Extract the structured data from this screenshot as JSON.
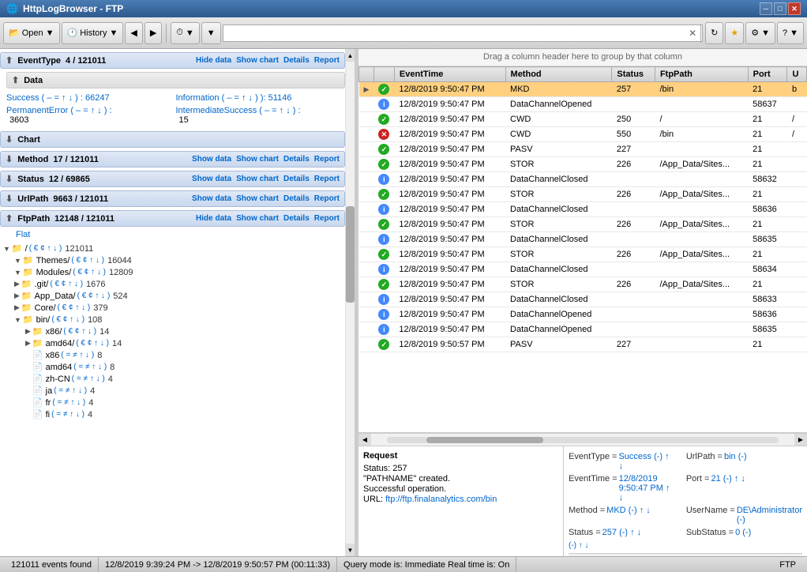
{
  "app": {
    "title": "HttpLogBrowser - FTP"
  },
  "titlebar": {
    "minimize": "─",
    "maximize": "□",
    "close": "✕"
  },
  "toolbar": {
    "open_label": "Open",
    "history_label": "History",
    "search_placeholder": "",
    "refresh_label": "↻",
    "filter_label": "▼"
  },
  "left_panel": {
    "event_type_header": "EventType",
    "event_type_count": "4 / 121011",
    "event_type_links": [
      "Hide data",
      "Show chart",
      "Details",
      "Report"
    ],
    "data_header": "Data",
    "success_label": "Success",
    "success_controls": "( –  =  ↑  ↓ )",
    "success_value": ": 66247",
    "information_label": "Information",
    "information_controls": "( –  =  ↑  ↓ )",
    "information_value": "): 51146",
    "permanent_error_label": "PermanentError",
    "permanent_error_controls": "( –  =  ↑  ↓ )",
    "permanent_error_value": "3603",
    "intermediate_success_label": "IntermediateSuccess",
    "intermediate_success_controls": "( –  =  ↑  ↓ )",
    "intermediate_success_value": "15",
    "chart_header": "Chart",
    "method_header": "Method",
    "method_count": "17 / 121011",
    "method_links": [
      "Show data",
      "Show chart",
      "Details",
      "Report"
    ],
    "status_header": "Status",
    "status_count": "12 / 69865",
    "status_links": [
      "Show data",
      "Show chart",
      "Details",
      "Report"
    ],
    "urlpath_header": "UrlPath",
    "urlpath_count": "9663 / 121011",
    "urlpath_links": [
      "Show data",
      "Show chart",
      "Details",
      "Report"
    ],
    "ftppath_header": "FtpPath",
    "ftppath_count": "12148 / 121011",
    "ftppath_links": [
      "Hide data",
      "Show chart",
      "Details",
      "Report"
    ],
    "ftppath_sub": "Flat",
    "tree_items": [
      {
        "indent": 0,
        "expand": true,
        "type": "folder",
        "name": "/",
        "controls": "( € ¢ ↑ ↓ )",
        "count": "121011"
      },
      {
        "indent": 1,
        "expand": true,
        "type": "folder",
        "name": "Themes/",
        "controls": "( € ¢ ↑ ↓ )",
        "count": "16044"
      },
      {
        "indent": 1,
        "expand": true,
        "type": "folder",
        "name": "Modules/",
        "controls": "( € ¢ ↑ ↓ )",
        "count": "12809"
      },
      {
        "indent": 1,
        "expand": false,
        "type": "folder",
        "name": ".git/",
        "controls": "( € ¢ ↑ ↓ )",
        "count": "1676"
      },
      {
        "indent": 1,
        "expand": false,
        "type": "folder",
        "name": "App_Data/",
        "controls": "( € ¢ ↑ ↓ )",
        "count": "524"
      },
      {
        "indent": 1,
        "expand": false,
        "type": "folder",
        "name": "Core/",
        "controls": "( € ¢ ↑ ↓ )",
        "count": "379"
      },
      {
        "indent": 1,
        "expand": true,
        "type": "folder",
        "name": "bin/",
        "controls": "( € ¢ ↑ ↓ )",
        "count": "108"
      },
      {
        "indent": 2,
        "expand": false,
        "type": "folder",
        "name": "x86/",
        "controls": "( € ¢ ↑ ↓ )",
        "count": "14"
      },
      {
        "indent": 2,
        "expand": false,
        "type": "folder",
        "name": "amd64/",
        "controls": "( € ¢ ↑ ↓ )",
        "count": "14"
      },
      {
        "indent": 2,
        "expand": false,
        "type": "file",
        "name": "x86",
        "controls": "( = ≠ ↑ ↓ )",
        "count": "8"
      },
      {
        "indent": 2,
        "expand": false,
        "type": "file",
        "name": "amd64",
        "controls": "( = ≠ ↑ ↓ )",
        "count": "8"
      },
      {
        "indent": 2,
        "expand": false,
        "type": "file",
        "name": "zh-CN",
        "controls": "( = ≠ ↑ ↓ )",
        "count": "4"
      },
      {
        "indent": 2,
        "expand": false,
        "type": "file",
        "name": "ja",
        "controls": "( = ≠ ↑ ↓ )",
        "count": "4"
      },
      {
        "indent": 2,
        "expand": false,
        "type": "file",
        "name": "fr",
        "controls": "( = ≠ ↑ ↓ )",
        "count": "4"
      },
      {
        "indent": 2,
        "expand": false,
        "type": "file",
        "name": "fi",
        "controls": "( = ≠ ↑ ↓ )",
        "count": "4"
      }
    ]
  },
  "right_panel": {
    "group_header": "Drag a column header here to group by that column",
    "columns": [
      "",
      "",
      "EventTime",
      "Method",
      "Status",
      "FtpPath",
      "Port",
      "U"
    ],
    "rows": [
      {
        "expand": true,
        "status": "green",
        "event_time": "12/8/2019 9:50:47 PM",
        "method": "MKD",
        "status_code": "257",
        "ftp_path": "/bin",
        "port": "21",
        "u": "b",
        "selected": true
      },
      {
        "expand": false,
        "status": "blue",
        "event_time": "12/8/2019 9:50:47 PM",
        "method": "DataChannelOpened",
        "status_code": "",
        "ftp_path": "",
        "port": "58637",
        "u": ""
      },
      {
        "expand": false,
        "status": "green",
        "event_time": "12/8/2019 9:50:47 PM",
        "method": "CWD",
        "status_code": "250",
        "ftp_path": "/",
        "port": "21",
        "u": "/"
      },
      {
        "expand": false,
        "status": "red",
        "event_time": "12/8/2019 9:50:47 PM",
        "method": "CWD",
        "status_code": "550",
        "ftp_path": "/bin",
        "port": "21",
        "u": "/"
      },
      {
        "expand": false,
        "status": "green",
        "event_time": "12/8/2019 9:50:47 PM",
        "method": "PASV",
        "status_code": "227",
        "ftp_path": "",
        "port": "21",
        "u": ""
      },
      {
        "expand": false,
        "status": "green",
        "event_time": "12/8/2019 9:50:47 PM",
        "method": "STOR",
        "status_code": "226",
        "ftp_path": "/App_Data/Sites...",
        "port": "21",
        "u": ""
      },
      {
        "expand": false,
        "status": "blue",
        "event_time": "12/8/2019 9:50:47 PM",
        "method": "DataChannelClosed",
        "status_code": "",
        "ftp_path": "",
        "port": "58632",
        "u": ""
      },
      {
        "expand": false,
        "status": "green",
        "event_time": "12/8/2019 9:50:47 PM",
        "method": "STOR",
        "status_code": "226",
        "ftp_path": "/App_Data/Sites...",
        "port": "21",
        "u": ""
      },
      {
        "expand": false,
        "status": "blue",
        "event_time": "12/8/2019 9:50:47 PM",
        "method": "DataChannelClosed",
        "status_code": "",
        "ftp_path": "",
        "port": "58636",
        "u": ""
      },
      {
        "expand": false,
        "status": "green",
        "event_time": "12/8/2019 9:50:47 PM",
        "method": "STOR",
        "status_code": "226",
        "ftp_path": "/App_Data/Sites...",
        "port": "21",
        "u": ""
      },
      {
        "expand": false,
        "status": "blue",
        "event_time": "12/8/2019 9:50:47 PM",
        "method": "DataChannelClosed",
        "status_code": "",
        "ftp_path": "",
        "port": "58635",
        "u": ""
      },
      {
        "expand": false,
        "status": "green",
        "event_time": "12/8/2019 9:50:47 PM",
        "method": "STOR",
        "status_code": "226",
        "ftp_path": "/App_Data/Sites...",
        "port": "21",
        "u": ""
      },
      {
        "expand": false,
        "status": "blue",
        "event_time": "12/8/2019 9:50:47 PM",
        "method": "DataChannelClosed",
        "status_code": "",
        "ftp_path": "",
        "port": "58634",
        "u": ""
      },
      {
        "expand": false,
        "status": "green",
        "event_time": "12/8/2019 9:50:47 PM",
        "method": "STOR",
        "status_code": "226",
        "ftp_path": "/App_Data/Sites...",
        "port": "21",
        "u": ""
      },
      {
        "expand": false,
        "status": "blue",
        "event_time": "12/8/2019 9:50:47 PM",
        "method": "DataChannelClosed",
        "status_code": "",
        "ftp_path": "",
        "port": "58633",
        "u": ""
      },
      {
        "expand": false,
        "status": "blue",
        "event_time": "12/8/2019 9:50:47 PM",
        "method": "DataChannelOpened",
        "status_code": "",
        "ftp_path": "",
        "port": "58636",
        "u": ""
      },
      {
        "expand": false,
        "status": "blue",
        "event_time": "12/8/2019 9:50:47 PM",
        "method": "DataChannelOpened",
        "status_code": "",
        "ftp_path": "",
        "port": "58635",
        "u": ""
      },
      {
        "expand": false,
        "status": "green",
        "event_time": "12/8/2019 9:50:57 PM",
        "method": "PASV",
        "status_code": "227",
        "ftp_path": "",
        "port": "21",
        "u": ""
      }
    ]
  },
  "request_panel": {
    "title": "Request",
    "status_line": "Status: 257",
    "message": "\"PATHNAME\" created.",
    "success": "Successful operation.",
    "url_label": "URL:",
    "url": "ftp://ftp.finalanalytics.com/bin"
  },
  "details_panel": {
    "event_type_label": "EventType =",
    "event_type_val": "Success",
    "event_type_controls": "(-) ↑ ↓",
    "url_path_label": "UrlPath =",
    "url_path_val": "bin",
    "url_path_suffix": "(-)",
    "event_time_label": "EventTime =",
    "event_time_val": "12/8/2019 9:50:47 PM",
    "event_time_controls": "↑ ↓",
    "port_label": "Port =",
    "port_val": "21",
    "port_controls": "(-) ↑ ↓",
    "method_label": "Method =",
    "method_val": "MKD",
    "method_controls": "(-) ↑ ↓",
    "username_label": "UserName =",
    "username_val": "DE\\Administrator (-)",
    "status_label": "Status =",
    "status_val": "257",
    "status_controls": "(-) ↑ ↓",
    "substatus_label": "SubStatus =",
    "substatus_val": "0 (-)",
    "controls_line": "(-) ↑ ↓"
  },
  "statusbar": {
    "events": "121011 events found",
    "range": "12/8/2019 9:39:24 PM  ->  12/8/2019 9:50:57 PM  (00:11:33)",
    "query_mode": "Query mode is:  Immediate  Real time is:  On",
    "ftp": "FTP"
  }
}
